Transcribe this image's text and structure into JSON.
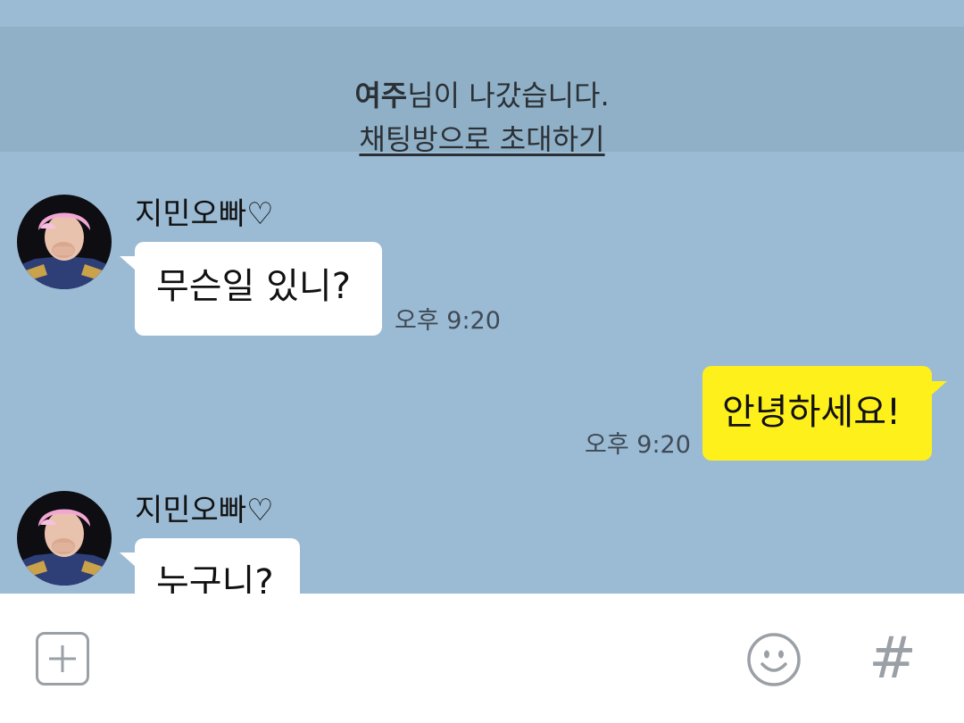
{
  "notice": {
    "left_name": "여주",
    "left_text": "님이 나갔습니다.",
    "invite_link": "채팅방으로 초대하기"
  },
  "messages": [
    {
      "direction": "in",
      "sender": "지민오빠♡",
      "text": "무슨일 있니?",
      "time": "오후 9:20"
    },
    {
      "direction": "out",
      "text": "안녕하세요!",
      "time": "오후 9:20"
    },
    {
      "direction": "in",
      "sender": "지민오빠♡",
      "text": "누구니?"
    }
  ],
  "input_bar": {
    "plus_icon": "plus-square-icon",
    "emoji_icon": "smiley-icon",
    "hash_label": "#"
  },
  "colors": {
    "chat_background": "#9bbbd4",
    "notice_background": "#8fb0c6",
    "incoming_bubble": "#ffffff",
    "outgoing_bubble": "#fef01b",
    "avatar_hair": "#f2a7d3"
  }
}
